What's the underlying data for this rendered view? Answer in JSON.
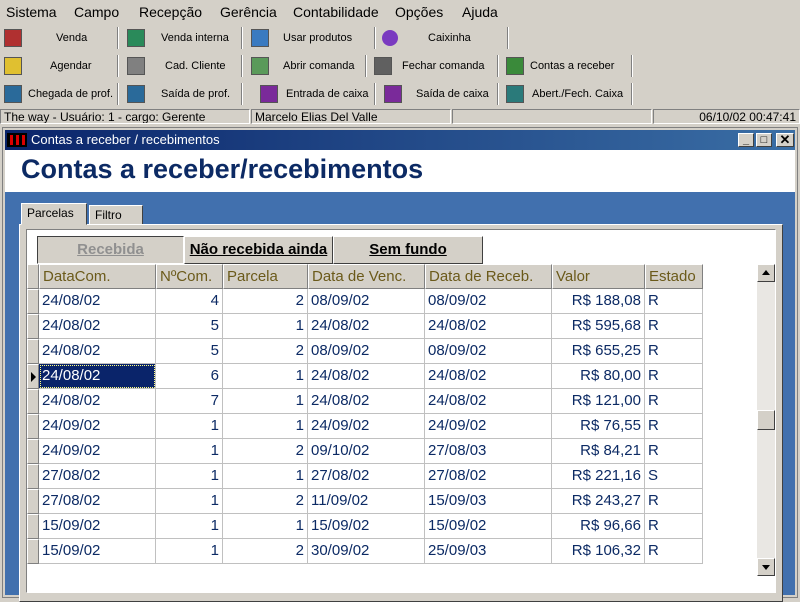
{
  "menu": [
    "Sistema",
    "Campo",
    "Recepção",
    "Gerência",
    "Contabilidade",
    "Opções",
    "Ajuda"
  ],
  "toolbar_rows": [
    [
      {
        "label": "Venda",
        "icon": "cash-register-icon"
      },
      {
        "label": "Venda interna",
        "icon": "internal-sale-icon"
      },
      {
        "label": "Usar produtos",
        "icon": "products-icon"
      },
      {
        "label": "Caixinha",
        "icon": "tip-box-icon"
      }
    ],
    [
      {
        "label": "Agendar",
        "icon": "schedule-icon"
      },
      {
        "label": "Cad. Cliente",
        "icon": "client-register-icon"
      },
      {
        "label": "Abrir comanda",
        "icon": "open-order-icon"
      },
      {
        "label": "Fechar comanda",
        "icon": "close-order-icon"
      },
      {
        "label": "Contas a receber",
        "icon": "receivables-icon"
      }
    ],
    [
      {
        "label": "Chegada de prof.",
        "icon": "arrival-icon"
      },
      {
        "label": "Saída de prof.",
        "icon": "departure-icon"
      },
      {
        "label": "Entrada de caixa",
        "icon": "cash-in-icon"
      },
      {
        "label": "Saída de caixa",
        "icon": "cash-out-icon"
      },
      {
        "label": "Abert./Fech. Caixa",
        "icon": "cash-open-close-icon"
      }
    ]
  ],
  "status": {
    "app": "The way - Usuário: 1 - cargo: Gerente",
    "user": "Marcelo Elias Del Valle",
    "empty": "",
    "datetime": "06/10/02 00:47:41"
  },
  "window": {
    "title": "Contas a receber / recebimentos"
  },
  "heading": "Contas a receber/recebimentos",
  "tabs": [
    "Parcelas",
    "Filtro"
  ],
  "subtabs": [
    "Recebida",
    "Não recebida ainda",
    "Sem fundo"
  ],
  "grid": {
    "columns": [
      "DataCom.",
      "NºCom.",
      "Parcela",
      "Data de Venc.",
      "Data de Receb.",
      "Valor",
      "Estado"
    ],
    "rows": [
      [
        "24/08/02",
        "4",
        "2",
        "08/09/02",
        "08/09/02",
        "R$ 188,08",
        "R"
      ],
      [
        "24/08/02",
        "5",
        "1",
        "24/08/02",
        "24/08/02",
        "R$ 595,68",
        "R"
      ],
      [
        "24/08/02",
        "5",
        "2",
        "08/09/02",
        "08/09/02",
        "R$ 655,25",
        "R"
      ],
      [
        "24/08/02",
        "6",
        "1",
        "24/08/02",
        "24/08/02",
        "R$ 80,00",
        "R"
      ],
      [
        "24/08/02",
        "7",
        "1",
        "24/08/02",
        "24/08/02",
        "R$ 121,00",
        "R"
      ],
      [
        "24/09/02",
        "1",
        "1",
        "24/09/02",
        "24/09/02",
        "R$ 76,55",
        "R"
      ],
      [
        "24/09/02",
        "1",
        "2",
        "09/10/02",
        "27/08/03",
        "R$ 84,21",
        "R"
      ],
      [
        "27/08/02",
        "1",
        "1",
        "27/08/02",
        "27/08/02",
        "R$ 221,16",
        "S"
      ],
      [
        "27/08/02",
        "1",
        "2",
        "11/09/02",
        "15/09/03",
        "R$ 243,27",
        "R"
      ],
      [
        "15/09/02",
        "1",
        "1",
        "15/09/02",
        "15/09/02",
        "R$ 96,66",
        "R"
      ],
      [
        "15/09/02",
        "1",
        "2",
        "30/09/02",
        "25/09/03",
        "R$ 106,32",
        "R"
      ]
    ],
    "current_row": 3
  }
}
